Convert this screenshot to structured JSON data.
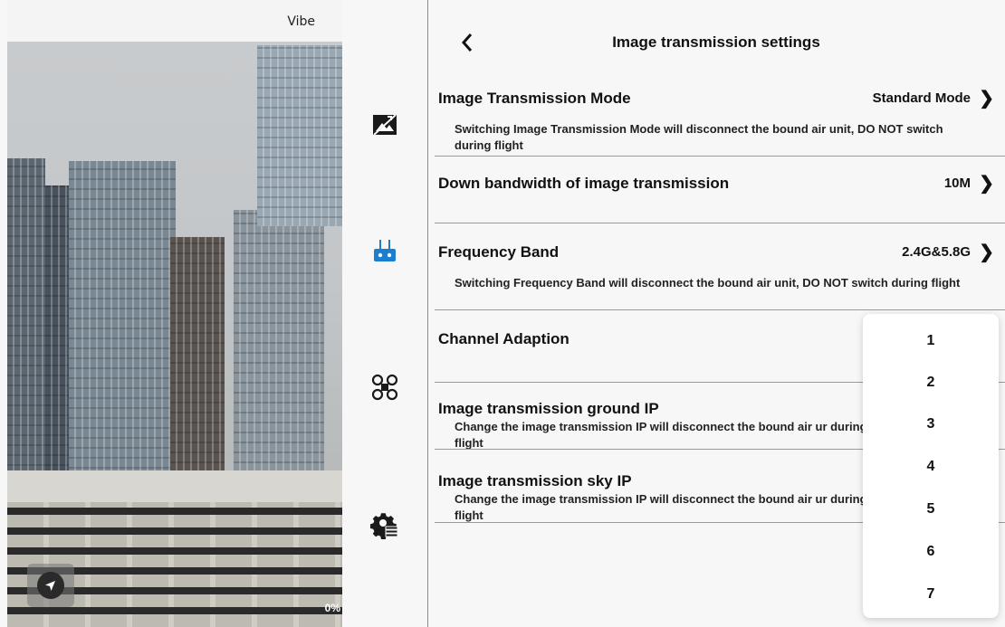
{
  "camera": {
    "overlay_label": "Vibe",
    "percent": "0%",
    "nav_button_icon": "navigation-arrow-icon"
  },
  "rail": {
    "icons": [
      "image-transmission-icon",
      "remote-controller-icon",
      "drone-icon",
      "settings-gear-icon"
    ]
  },
  "panel": {
    "title": "Image transmission settings",
    "back_icon": "chevron-left-icon",
    "rows": [
      {
        "label": "Image Transmission Mode",
        "value": "Standard Mode",
        "desc": "Switching Image Transmission Mode will disconnect the bound air unit, DO NOT switch during flight"
      },
      {
        "label": "Down bandwidth of image transmission",
        "value": "10M",
        "desc": ""
      },
      {
        "label": "Frequency Band",
        "value": "2.4G&5.8G",
        "desc": "Switching Frequency Band will disconnect the bound air unit, DO NOT switch during flight"
      },
      {
        "label": "Channel Adaption",
        "value": "",
        "desc": ""
      },
      {
        "label": "Image transmission ground IP",
        "value": "",
        "desc": "Change the image transmission IP will disconnect the bound air ur during flight"
      },
      {
        "label": "Image transmission sky IP",
        "value": "",
        "desc": "Change the image transmission IP will disconnect the bound air ur during flight"
      }
    ]
  },
  "dropdown": {
    "options": [
      "1",
      "2",
      "3",
      "4",
      "5",
      "6",
      "7"
    ]
  }
}
